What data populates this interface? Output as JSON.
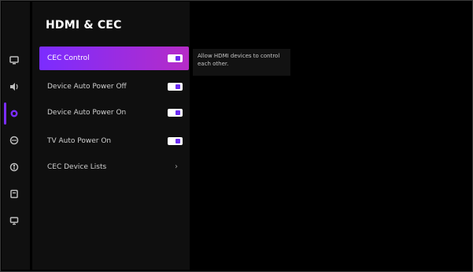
{
  "header": {
    "title": "HDMI & CEC"
  },
  "menu": [
    {
      "label": "CEC Control",
      "type": "toggle",
      "on": true,
      "selected": true
    },
    {
      "label": "Device Auto Power Off",
      "type": "toggle",
      "on": true,
      "selected": false
    },
    {
      "label": "Device Auto Power On",
      "type": "toggle",
      "on": true,
      "selected": false
    },
    {
      "label": "TV Auto Power On",
      "type": "toggle",
      "on": true,
      "selected": false
    },
    {
      "label": "CEC Device Lists",
      "type": "chevron",
      "selected": false
    }
  ],
  "description": "Allow HDMI devices to control each other.",
  "icons": {
    "rail": [
      "display-icon",
      "sound-icon",
      "settings-icon",
      "network-icon",
      "accessibility-icon",
      "storage-icon",
      "support-icon"
    ],
    "chevron": "chevron-right-icon"
  },
  "colors": {
    "accent": "#7b2dff",
    "accent_end": "#b62cc7",
    "toggle_knob": "#6d2df3"
  }
}
